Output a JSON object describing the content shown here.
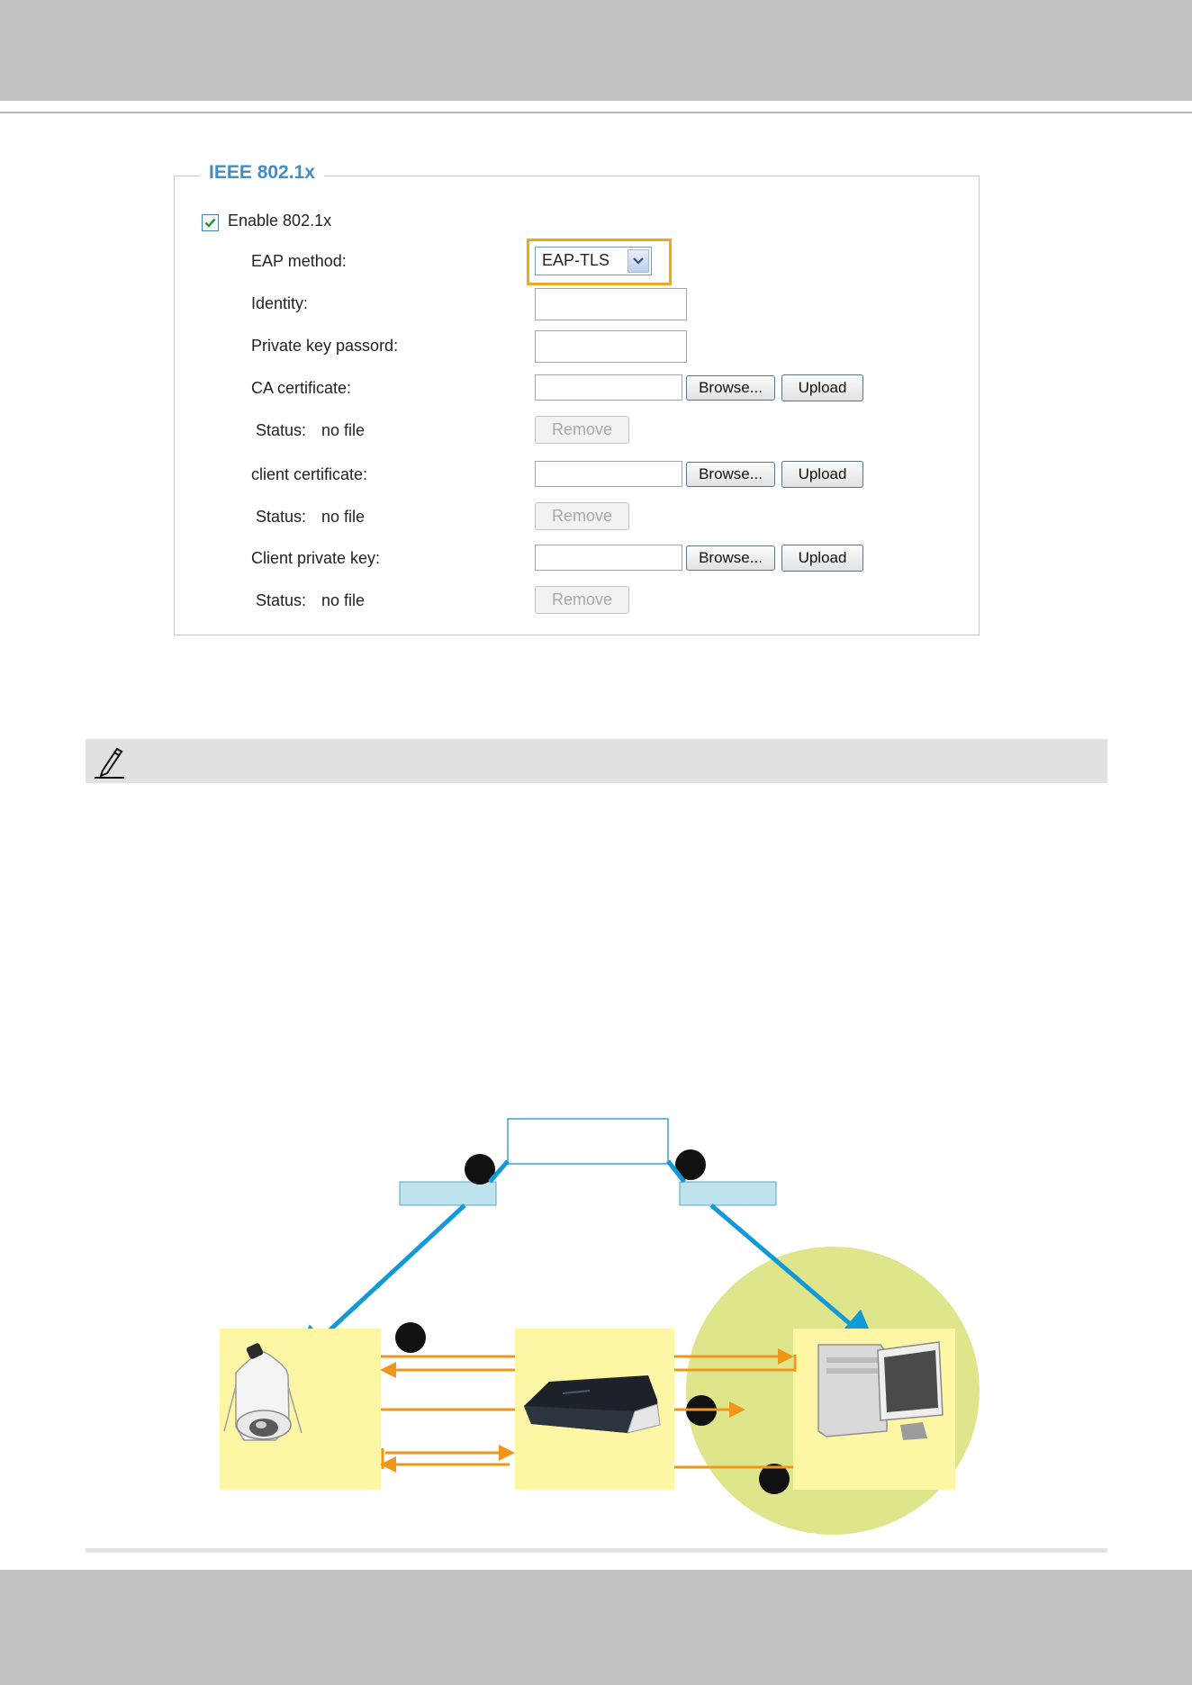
{
  "panel": {
    "title": "IEEE 802.1x",
    "enable_label": "Enable 802.1x",
    "enable_checked": true,
    "eap_method_label": "EAP method:",
    "eap_method_value": "EAP-TLS",
    "identity_label": "Identity:",
    "private_key_label": "Private key passord:",
    "ca_certificate_label": "CA certificate:",
    "client_certificate_label": "client certificate:",
    "client_private_key_label": "Client private key:",
    "status_label": "Status:",
    "status_value": "no file",
    "browse_label": "Browse...",
    "upload_label": "Upload",
    "remove_label": "Remove"
  },
  "colors": {
    "accent_title": "#3d8ec9",
    "highlight": "#efa71d",
    "diagram_arrow": "#129ad8",
    "diagram_flow": "#f29619",
    "diagram_zone": "#dfe58a",
    "diagram_box": "#fdf6a4"
  },
  "icons": {
    "note": "pencil-note-icon",
    "camera": "camera-icon",
    "switch": "network-switch-icon",
    "server": "computer-server-icon",
    "dropdown": "chevron-down-icon",
    "checkbox": "checkmark-icon"
  }
}
